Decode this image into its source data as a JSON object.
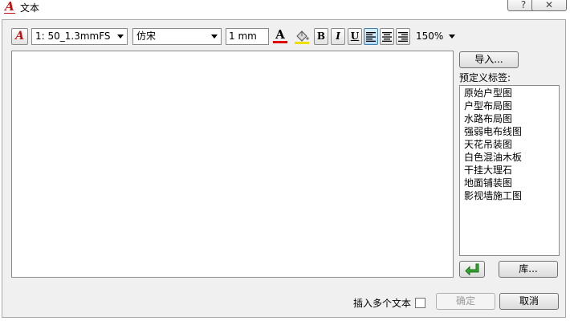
{
  "window": {
    "title": "文本",
    "title_icon_glyph": "A",
    "help_label": "?",
    "close_label": "✕"
  },
  "toolbar": {
    "style_icon_glyph": "A",
    "style_select_value": "1: 50_1.3mmFS",
    "font_select_value": "仿宋",
    "height_value": "1 mm",
    "font_color_glyph": "A",
    "font_color": "#e00000",
    "background_color": "#f0e000",
    "bold_label": "B",
    "italic_label": "I",
    "underline_label": "U",
    "align_active": "left",
    "zoom_value": "150%"
  },
  "editor": {
    "content": ""
  },
  "sidebar": {
    "import_button": "导入...",
    "predefined_label": "预定义标签:",
    "tags": [
      "原始户型图",
      "户型布局图",
      "水路布局图",
      "强弱电布线图",
      "天花吊装图",
      "白色混油木板",
      "干挂大理石",
      "地面铺装图",
      "影视墙施工图"
    ],
    "insert_icon": "enter-arrow-icon",
    "library_button": "库..."
  },
  "footer": {
    "insert_multiple_label": "插入多个文本",
    "insert_multiple_checked": false,
    "ok_button": "确定",
    "cancel_button": "取消"
  }
}
